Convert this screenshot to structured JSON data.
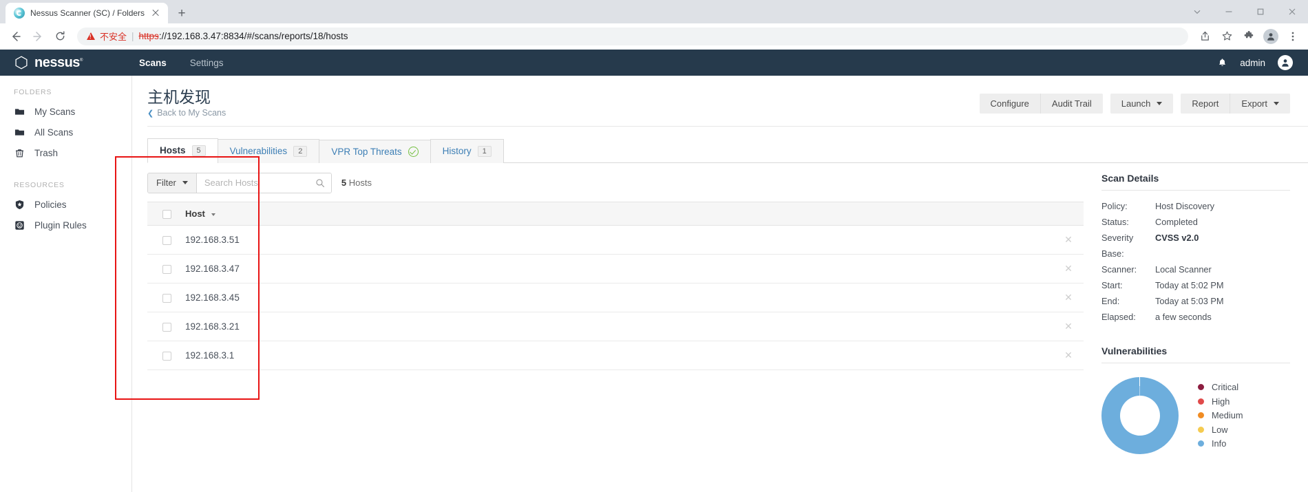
{
  "browser": {
    "tab": {
      "title": "Nessus Scanner (SC) / Folders",
      "favicon_name": "nessus-favicon"
    },
    "newtab_label": "+",
    "window_controls": [
      "chevron-down",
      "minimize",
      "maximize",
      "close"
    ],
    "nav": {
      "back": "←",
      "forward": "→",
      "reload": "⟳"
    },
    "omnibox": {
      "security_label": "不安全",
      "url_scheme": "https",
      "url_rest": "://192.168.3.47:8834/#/scans/reports/18/hosts",
      "full_url": "https://192.168.3.47:8834/#/scans/reports/18/hosts"
    },
    "toolbar_icons": [
      "share-icon",
      "bookmark-star-icon",
      "extensions-puzzle-icon",
      "profile-avatar-icon",
      "more-menu-icon"
    ]
  },
  "header": {
    "brand": "nessus",
    "nav": [
      {
        "label": "Scans",
        "active": true
      },
      {
        "label": "Settings",
        "active": false
      }
    ],
    "notifications_icon": "bell-icon",
    "user": "admin",
    "avatar_icon": "user-avatar-icon"
  },
  "sidebar": {
    "sections": [
      {
        "label": "FOLDERS",
        "items": [
          {
            "label": "My Scans",
            "icon": "folder-icon"
          },
          {
            "label": "All Scans",
            "icon": "folder-icon"
          },
          {
            "label": "Trash",
            "icon": "trash-icon"
          }
        ]
      },
      {
        "label": "RESOURCES",
        "items": [
          {
            "label": "Policies",
            "icon": "shield-star-icon"
          },
          {
            "label": "Plugin Rules",
            "icon": "plugin-icon"
          }
        ]
      }
    ]
  },
  "page": {
    "title": "主机发现",
    "back_label": "Back to My Scans",
    "actions": {
      "configure": "Configure",
      "audit_trail": "Audit Trail",
      "launch": "Launch",
      "report": "Report",
      "export": "Export"
    }
  },
  "tabs": [
    {
      "label": "Hosts",
      "badge": "5",
      "active": true
    },
    {
      "label": "Vulnerabilities",
      "badge": "2",
      "active": false
    },
    {
      "label": "VPR Top Threats",
      "badge": null,
      "icon": "check-circle-icon",
      "active": false
    },
    {
      "label": "History",
      "badge": "1",
      "active": false
    }
  ],
  "filterbar": {
    "filter_label": "Filter",
    "search_placeholder": "Search Hosts",
    "search_value": "",
    "search_icon": "search-icon",
    "count_number": "5",
    "count_label": "Hosts"
  },
  "table": {
    "columns": [
      "Host"
    ],
    "rows": [
      {
        "host": "192.168.3.51"
      },
      {
        "host": "192.168.3.47"
      },
      {
        "host": "192.168.3.45"
      },
      {
        "host": "192.168.3.21"
      },
      {
        "host": "192.168.3.1"
      }
    ],
    "remove_icon": "close-x-icon"
  },
  "scan_details": {
    "title": "Scan Details",
    "rows": [
      {
        "key": "Policy:",
        "value": "Host Discovery",
        "bold": false
      },
      {
        "key": "Status:",
        "value": "Completed",
        "bold": false
      },
      {
        "key": "Severity Base:",
        "value": "CVSS v2.0",
        "bold": true
      },
      {
        "key": "Scanner:",
        "value": "Local Scanner",
        "bold": false
      },
      {
        "key": "Start:",
        "value": "Today at 5:02 PM",
        "bold": false
      },
      {
        "key": "End:",
        "value": "Today at 5:03 PM",
        "bold": false
      },
      {
        "key": "Elapsed:",
        "value": "a few seconds",
        "bold": false
      }
    ]
  },
  "vulnerabilities": {
    "title": "Vulnerabilities"
  },
  "chart_data": {
    "type": "pie",
    "title": "Vulnerabilities",
    "categories": [
      "Critical",
      "High",
      "Medium",
      "Low",
      "Info"
    ],
    "values": [
      0,
      0,
      0,
      0,
      100
    ],
    "colors": [
      "#8c1d40",
      "#e04a4a",
      "#f08c23",
      "#f5cb50",
      "#6daedd"
    ],
    "legend_position": "right",
    "donut": true
  },
  "annotation": {
    "color": "#e81313",
    "name": "hosts-table-highlight"
  }
}
